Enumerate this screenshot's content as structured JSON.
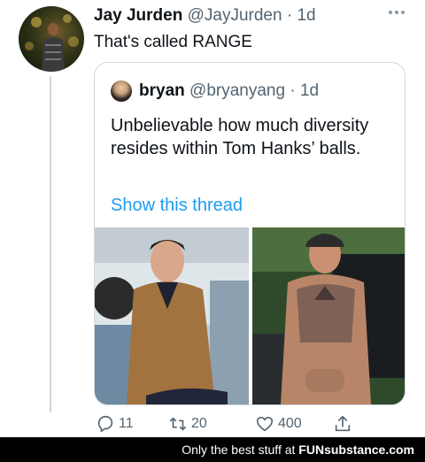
{
  "tweet": {
    "author_name": "Jay Jurden",
    "author_handle": "@JayJurden",
    "separator": "·",
    "time": "1d",
    "text": "That's called RANGE",
    "more_icon": "more-dots-icon"
  },
  "quoted_tweet": {
    "author_name": "bryan",
    "author_handle": "@bryanyang",
    "separator": "·",
    "time": "1d",
    "text": "Unbelievable how much diversity resides within Tom Hanks’ balls.",
    "link": "Show this thread",
    "media": [
      {
        "name": "photo-man-in-jacket"
      },
      {
        "name": "photo-man-tattooed-torso"
      }
    ]
  },
  "actions": {
    "reply": {
      "icon": "reply-icon",
      "count": "11"
    },
    "retweet": {
      "icon": "retweet-icon",
      "count": "20"
    },
    "like": {
      "icon": "heart-icon",
      "count": "400"
    },
    "share": {
      "icon": "share-icon"
    }
  },
  "footer": {
    "text": "Only the best stuff at",
    "brand": "FUNsubstance.com"
  },
  "colors": {
    "link": "#1d9bf0",
    "muted": "#536471",
    "border": "#cfd9de"
  }
}
